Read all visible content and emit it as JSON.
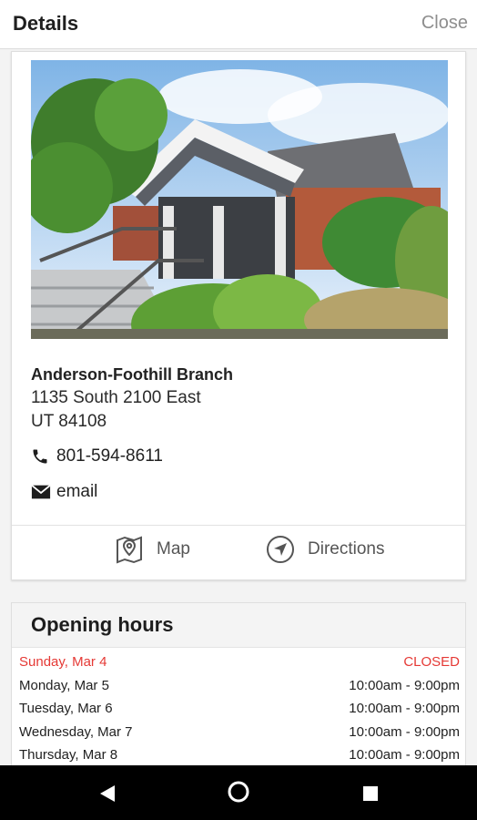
{
  "header": {
    "title": "Details",
    "close_label": "Close"
  },
  "branch": {
    "name": "Anderson-Foothill Branch",
    "address_line1": "1135 South 2100 East",
    "address_line2": "UT 84108",
    "phone": "801-594-8611",
    "email_label": "email"
  },
  "actions": {
    "map_label": "Map",
    "directions_label": "Directions"
  },
  "hours": {
    "title": "Opening hours",
    "rows": [
      {
        "day": "Sunday, Mar 4",
        "time": "CLOSED"
      },
      {
        "day": "Monday, Mar 5",
        "time": "10:00am - 9:00pm"
      },
      {
        "day": "Tuesday, Mar 6",
        "time": "10:00am - 9:00pm"
      },
      {
        "day": "Wednesday, Mar 7",
        "time": "10:00am - 9:00pm"
      },
      {
        "day": "Thursday, Mar 8",
        "time": "10:00am - 9:00pm"
      }
    ]
  },
  "colors": {
    "closed": "#e53935",
    "navbar": "#000000"
  },
  "icons": {
    "phone": "phone-icon",
    "email": "envelope-icon",
    "map": "map-pin-icon",
    "directions": "navigation-arrow-icon",
    "back": "back-triangle-icon",
    "home": "home-circle-icon",
    "recents": "recents-square-icon"
  }
}
